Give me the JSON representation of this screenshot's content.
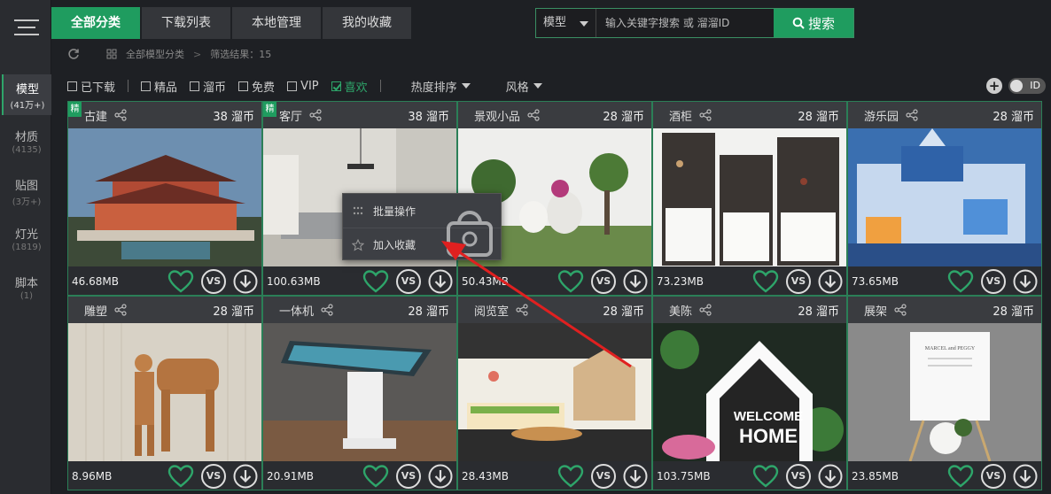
{
  "sidebar": {
    "items": [
      {
        "label": "模型",
        "count": "(41万+)",
        "active": true
      },
      {
        "label": "材质",
        "count": "(4135)"
      },
      {
        "label": "贴图",
        "count": "(3万+)"
      },
      {
        "label": "灯光",
        "count": "(1819)"
      },
      {
        "label": "脚本",
        "count": "(1)"
      }
    ]
  },
  "tabs": [
    {
      "label": "全部分类",
      "active": true
    },
    {
      "label": "下载列表"
    },
    {
      "label": "本地管理"
    },
    {
      "label": "我的收藏"
    }
  ],
  "search": {
    "type": "模型",
    "placeholder": "输入关键字搜索 或 溜溜ID",
    "button": "搜索"
  },
  "breadcrumb": {
    "root": "全部模型分类",
    "sep": ">",
    "result": "筛选结果：15"
  },
  "filters": {
    "checks": [
      {
        "label": "已下载",
        "checked": false
      },
      {
        "label": "精品",
        "checked": false
      },
      {
        "label": "溜币",
        "checked": false
      },
      {
        "label": "免费",
        "checked": false
      },
      {
        "label": "VIP",
        "checked": false
      },
      {
        "label": "喜欢",
        "checked": true
      }
    ],
    "sort": "热度排序",
    "style": "风格",
    "toggle_label": "ID"
  },
  "cards": [
    {
      "name": "古建",
      "price": "38 溜币",
      "size": "46.68MB",
      "jing": "精"
    },
    {
      "name": "客厅",
      "price": "38 溜币",
      "size": "100.63MB",
      "jing": "精"
    },
    {
      "name": "景观小品",
      "price": "28 溜币",
      "size": "50.43MB"
    },
    {
      "name": "酒柜",
      "price": "28 溜币",
      "size": "73.23MB"
    },
    {
      "name": "游乐园",
      "price": "28 溜币",
      "size": "73.65MB"
    },
    {
      "name": "雕塑",
      "price": "28 溜币",
      "size": "8.96MB"
    },
    {
      "name": "一体机",
      "price": "28 溜币",
      "size": "20.91MB"
    },
    {
      "name": "阅览室",
      "price": "28 溜币",
      "size": "28.43MB"
    },
    {
      "name": "美陈",
      "price": "28 溜币",
      "size": "103.75MB"
    },
    {
      "name": "展架",
      "price": "28 溜币",
      "size": "23.85MB"
    }
  ],
  "context_menu": {
    "items": [
      "批量操作",
      "加入收藏"
    ]
  },
  "vs_label": "VS",
  "thumb_text": {
    "welcome": "WELCOME",
    "home": "HOME",
    "sign": "MARCEL and PEGGY"
  },
  "colors": {
    "accent": "#1f9c5f",
    "card_border": "#2b7f57",
    "bg": "#1e2024"
  }
}
